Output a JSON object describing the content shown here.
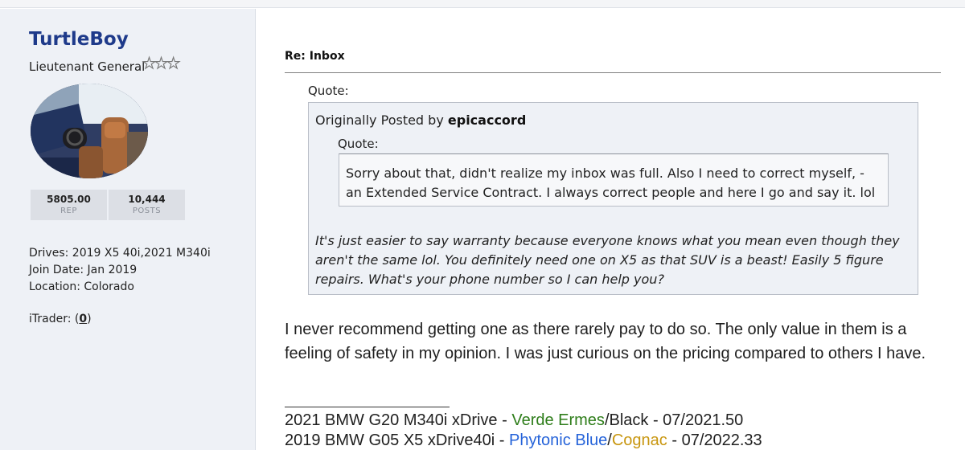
{
  "user": {
    "name": "TurtleBoy",
    "rank": "Lieutenant General",
    "rep_value": "5805.00",
    "rep_label": "REP",
    "posts_value": "10,444",
    "posts_label": "POSTS",
    "drives": "Drives: 2019 X5 40i,2021 M340i",
    "join_date": "Join Date: Jan 2019",
    "location": "Location: Colorado",
    "itrader_label": "iTrader: (",
    "itrader_value": "0",
    "itrader_close": ")"
  },
  "post": {
    "title": "Re: Inbox",
    "quote_label": "Quote:",
    "originally_posted_by": "Originally Posted by",
    "quoted_author": "epicaccord",
    "inner_quote_label": "Quote:",
    "inner_quote_text": "Sorry about that, didn't realize my inbox was full. Also I need to correct myself, - an Extended Service Contract. I always correct people and here I go and say it. lol",
    "outer_quote_text": "It's just easier to say warranty because everyone knows what you mean even though they aren't the same lol. You definitely need one on X5 as that SUV is a beast! Easily 5 figure repairs. What's your phone number so I can help you?",
    "body": "I never recommend getting one as there rarely pay to do so. The only value in them is a feeling of safety in my opinion. I was just curious on the pricing compared to others I have."
  },
  "signature": {
    "line1_prefix": "2021 BMW G20 M340i xDrive - ",
    "line1_color": "Verde Ermes",
    "line1_suffix": "/Black - 07/2021.50",
    "line2_prefix": "2019 BMW G05 X5 xDrive40i - ",
    "line2_color1": "Phytonic Blue",
    "line2_sep": "/",
    "line2_color2": "Cognac",
    "line2_suffix": " - 07/2022.33"
  },
  "colors": {
    "username": "#1e3a8a",
    "verde_ermes": "#2e7d1a",
    "phytonic_blue": "#2563d9",
    "cognac": "#c8960f"
  }
}
